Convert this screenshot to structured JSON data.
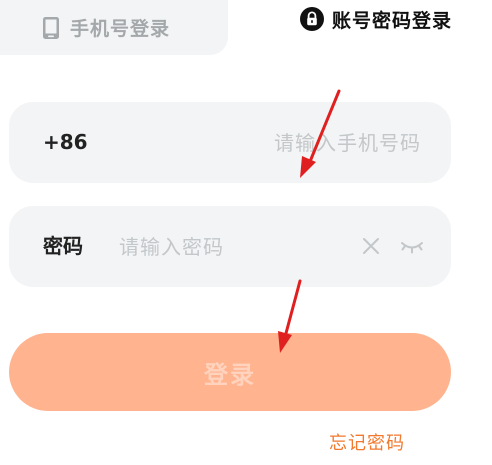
{
  "tabs": {
    "phone_login_label": "手机号登录",
    "password_login_label": "账号密码登录"
  },
  "phone_field": {
    "prefix": "+86",
    "value": "",
    "placeholder": "请输入手机号码"
  },
  "password_field": {
    "label": "密码",
    "value": "",
    "placeholder": "请输入密码"
  },
  "login_button": {
    "label": "登录"
  },
  "forgot_password": {
    "label": "忘记密码"
  },
  "colors": {
    "field_background": "#f2f4f5",
    "button_background": "#ffb38f",
    "button_text": "#ffd3bd",
    "link": "#f2792e",
    "annotation_arrow": "#e02020"
  },
  "icons": {
    "phone_tab": "phone-icon",
    "password_tab": "lock-icon",
    "clear": "close-icon",
    "visibility": "eye-closed-icon"
  }
}
